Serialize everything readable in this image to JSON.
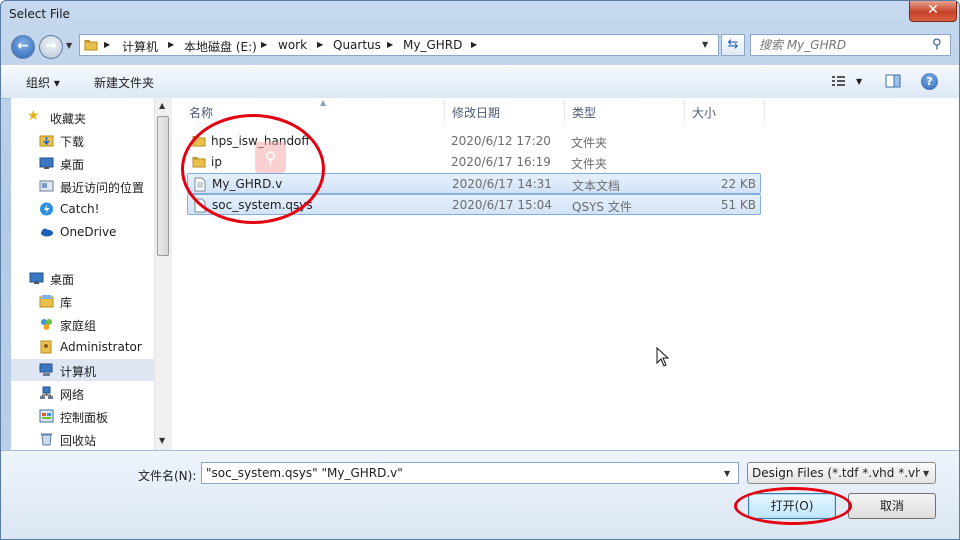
{
  "window": {
    "title": "Select File",
    "close_glyph": "✕"
  },
  "address": {
    "crumbs": [
      "计算机",
      "本地磁盘 (E:)",
      "work",
      "Quartus",
      "My_GHRD"
    ],
    "search_placeholder": "搜索 My_GHRD"
  },
  "toolbar": {
    "organize": "组织 ▾",
    "new_folder": "新建文件夹",
    "help": "?"
  },
  "sidebar": {
    "favorites_header": "收藏夹",
    "favorites": [
      "下载",
      "桌面",
      "最近访问的位置",
      "Catch!",
      "OneDrive"
    ],
    "tree": [
      "桌面",
      "库",
      "家庭组",
      "Administrator",
      "计算机",
      "网络",
      "控制面板",
      "回收站"
    ],
    "selected": "计算机"
  },
  "columns": {
    "name": "名称",
    "modified": "修改日期",
    "type": "类型",
    "size": "大小"
  },
  "files": [
    {
      "name": "hps_isw_handoff",
      "modified": "2020/6/12 17:20",
      "type": "文件夹",
      "size": "",
      "kind": "folder-icon",
      "selected": false
    },
    {
      "name": "ip",
      "modified": "2020/6/17 16:19",
      "type": "文件夹",
      "size": "",
      "kind": "folder-icon",
      "selected": false
    },
    {
      "name": "My_GHRD.v",
      "modified": "2020/6/17 14:31",
      "type": "文本文档",
      "size": "22 KB",
      "kind": "text-file-icon",
      "selected": true
    },
    {
      "name": "soc_system.qsys",
      "modified": "2020/6/17 15:04",
      "type": "QSYS 文件",
      "size": "51 KB",
      "kind": "document-icon",
      "selected": true
    }
  ],
  "footer": {
    "filename_label": "文件名(N):",
    "filename_value": "\"soc_system.qsys\" \"My_GHRD.v\"",
    "filetype_value": "Design Files (*.tdf *.vhd *.vhd",
    "open_label": "打开(O)",
    "cancel_label": "取消"
  },
  "colors": {
    "annotation_ring": "#e4000f",
    "selection": "#d2e3f8",
    "accent": "#2d63b3"
  }
}
